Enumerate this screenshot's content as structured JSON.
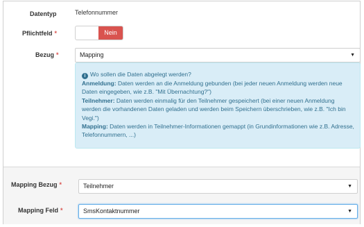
{
  "fields": {
    "datentyp": {
      "label": "Datentyp",
      "value": "Telefonnummer"
    },
    "pflichtfeld": {
      "label": "Pflichtfeld",
      "required_mark": "*",
      "toggle_off_label": "Nein"
    },
    "bezug": {
      "label": "Bezug",
      "required_mark": "*",
      "value": "Mapping"
    },
    "mapping_bezug": {
      "label": "Mapping Bezug",
      "required_mark": "*",
      "value": "Teilnehmer"
    },
    "mapping_feld": {
      "label": "Mapping Feld",
      "required_mark": "*",
      "value": "SmsKontaktnummer"
    }
  },
  "info": {
    "question": "Wo sollen die Daten abgelegt werden?",
    "anmeldung_term": "Anmeldung:",
    "anmeldung_text": " Daten werden an die Anmeldung gebunden (bei jeder neuen Anmeldung werden neue Daten eingegeben, wie z.B. \"Mit Übernachtung?\")",
    "teilnehmer_term": "Teilnehmer:",
    "teilnehmer_text": " Daten werden einmalig für den Teilnehmer gespeichert (bei einer neuen Anmeldung werden die vorhandenen Daten geladen und werden beim Speichern überschrieben, wie z.B. \"Ich bin Vegi.\")",
    "mapping_term": "Mapping:",
    "mapping_text": " Daten werden in Teilnehmer-Informationen gemappt (in Grundinformationen wie z.B. Adresse, Telefonnummern, ...)"
  },
  "colors": {
    "required": "#d9534f",
    "toggle_off_bg": "#d9534f",
    "info_bg": "#d9edf7",
    "info_text": "#31708f",
    "focus_border": "#66afe9"
  },
  "icons": {
    "info": "info-circle-icon",
    "caret": "chevron-down-icon"
  }
}
